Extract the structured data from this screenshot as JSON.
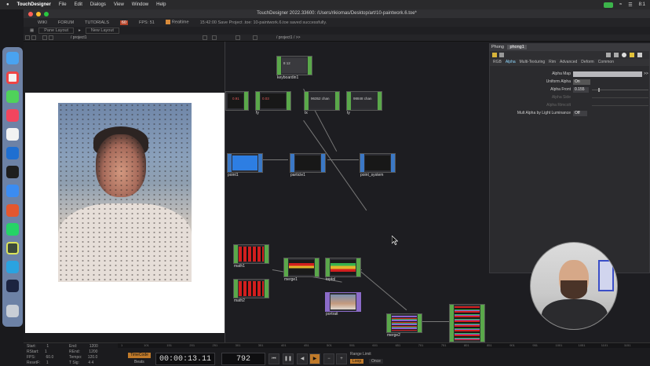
{
  "menubar": {
    "app_name": "TouchDesigner",
    "items": [
      "File",
      "Edit",
      "Dialogs",
      "View",
      "Window",
      "Help"
    ],
    "clock": "8:1"
  },
  "window": {
    "title": "TouchDesigner 2022.33600: /Users/rikiomas/Desktop/art/10-paintwork.6.toe*"
  },
  "td_menu": {
    "logo": "WIKI",
    "forum": "FORUM",
    "tutorials": "TUTORIALS",
    "badge": "60",
    "fps": "FPS: 51",
    "realtime": "Realtime",
    "status": "15:42:00 Save Project .toe: 10-paintwork.6.toe saved successfully."
  },
  "layout_bar": {
    "pane_layout": "Pane Layout",
    "new_layout": "New Layout"
  },
  "path_left": "/ project1",
  "path_right": "/ project1 / >>",
  "operators": {
    "keyboardin1": {
      "label": "keyboardin1",
      "value": "8 12"
    },
    "op_a": {
      "label": "",
      "value": "0.91"
    },
    "fy": {
      "label": "fy",
      "value": "0.03"
    },
    "tx": {
      "label": "tx",
      "value": "96352 chan"
    },
    "ty": {
      "label": "ty",
      "value": "98848 chan"
    },
    "point1": {
      "label": "point1"
    },
    "particle1": {
      "label": "particle1"
    },
    "point_system": {
      "label": "point_system"
    },
    "math1": {
      "label": "math1"
    },
    "math2": {
      "label": "math2"
    },
    "merge1": {
      "label": "merge1"
    },
    "toptol": {
      "label": "toptol"
    },
    "portrait": {
      "label": "portrait"
    },
    "merge2": {
      "label": "merge2"
    }
  },
  "params": {
    "op_type": "Phong",
    "op_name": "phong1",
    "tabs": [
      "RGB",
      "Alpha",
      "Multi-Texturing",
      "Rim",
      "Advanced",
      "Deform",
      "Common"
    ],
    "active_tab": "Alpha",
    "rows": [
      {
        "label": "Alpha Map",
        "value": ""
      },
      {
        "label": "Uniform Alpha",
        "value": "On"
      },
      {
        "label": "Alpha Front",
        "value": "0.155"
      },
      {
        "label": "Alpha Side",
        "value": ""
      },
      {
        "label": "Alpha Rimcolt",
        "value": ""
      },
      {
        "label": "Mult Alpha by Light Luminance",
        "value": "Off"
      }
    ]
  },
  "timeline": {
    "info": [
      {
        "label": "Start:",
        "value": "1",
        "label2": "End:",
        "value2": "1200"
      },
      {
        "label": "RStart:",
        "value": "1",
        "label2": "REnd:",
        "value2": "1200"
      },
      {
        "label": "FPS:",
        "value": "60.0",
        "label2": "Tempo:",
        "value2": "120.0"
      },
      {
        "label": "ResetF:",
        "value": "1",
        "label2": "T Sig:",
        "value2": "4  4"
      }
    ],
    "ruler_ticks": [
      "1",
      "101",
      "151",
      "201",
      "251",
      "301",
      "351",
      "401",
      "451",
      "501",
      "551",
      "601",
      "651",
      "701",
      "751",
      "801",
      "851",
      "901",
      "951",
      "1001",
      "1051",
      "1101",
      "1151"
    ],
    "timecode_label": "TimeCode",
    "beats_label": "Beats",
    "timecode": "00:00:13.11",
    "frame": "792",
    "range_limit": "Range Limit",
    "loop": "Loop",
    "once": "Once"
  }
}
